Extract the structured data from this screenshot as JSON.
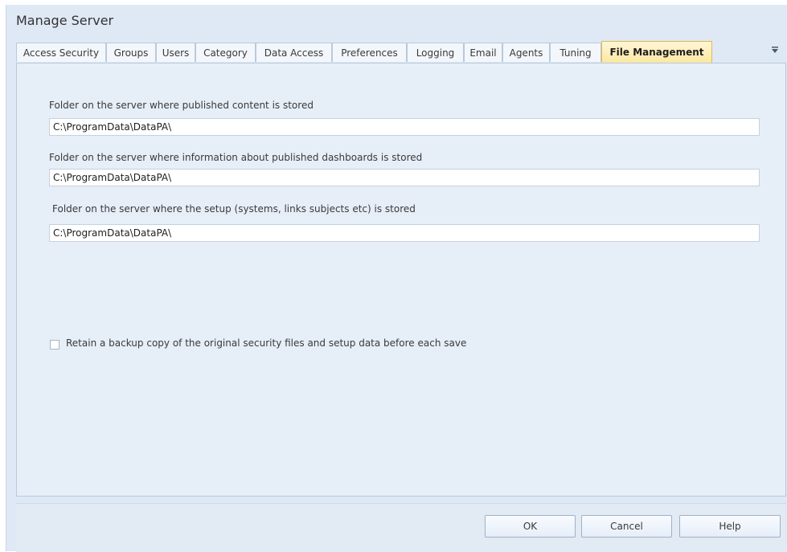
{
  "window": {
    "title": "Manage Server"
  },
  "tabs": [
    {
      "label": "Access Security",
      "active": false
    },
    {
      "label": "Groups",
      "active": false
    },
    {
      "label": "Users",
      "active": false
    },
    {
      "label": "Category",
      "active": false
    },
    {
      "label": "Data Access",
      "active": false
    },
    {
      "label": "Preferences",
      "active": false
    },
    {
      "label": "Logging",
      "active": false
    },
    {
      "label": "Email",
      "active": false
    },
    {
      "label": "Agents",
      "active": false
    },
    {
      "label": "Tuning",
      "active": false
    },
    {
      "label": "File Management",
      "active": true
    }
  ],
  "tab_overflow_icon": "chevron-down-icon",
  "fields": [
    {
      "label": "Folder on the server where published content is stored",
      "value": "C:\\ProgramData\\DataPA\\"
    },
    {
      "label": "Folder on the server where information about published dashboards is stored",
      "value": "C:\\ProgramData\\DataPA\\"
    },
    {
      "label": "Folder on the server where the setup (systems, links subjects etc) is stored",
      "value": "C:\\ProgramData\\DataPA\\"
    }
  ],
  "backup_option": {
    "label": "Retain a backup copy of the original security files and setup data before each save",
    "checked": false
  },
  "buttons": {
    "ok": "OK",
    "cancel": "Cancel",
    "help": "Help"
  },
  "colors": {
    "window_background": "#dfe9f5",
    "active_tab": "#fde7a0",
    "content_background": "#e6eef8"
  }
}
